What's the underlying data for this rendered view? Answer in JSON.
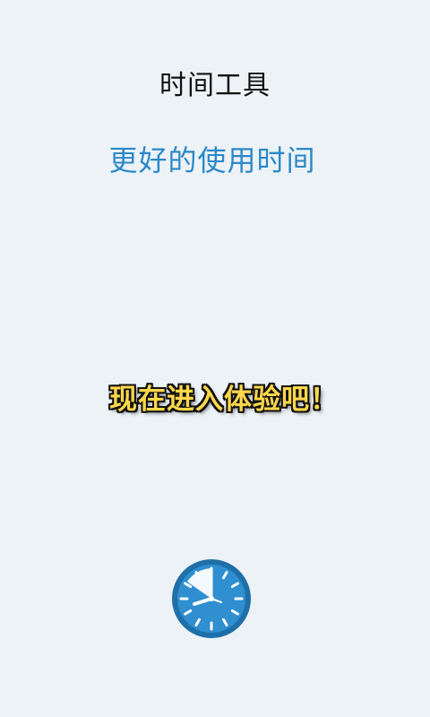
{
  "header": {
    "title": "时间工具",
    "subtitle": "更好的使用时间"
  },
  "main": {
    "cta_text": "现在进入体验吧！"
  },
  "footer": {
    "icon": "clock-icon"
  },
  "colors": {
    "background": "#edf2f7",
    "title": "#111111",
    "subtitle": "#2b88c8",
    "cta_fill": "#ffd84a",
    "cta_outline": "#111111",
    "clock_blue": "#2a86c4"
  }
}
